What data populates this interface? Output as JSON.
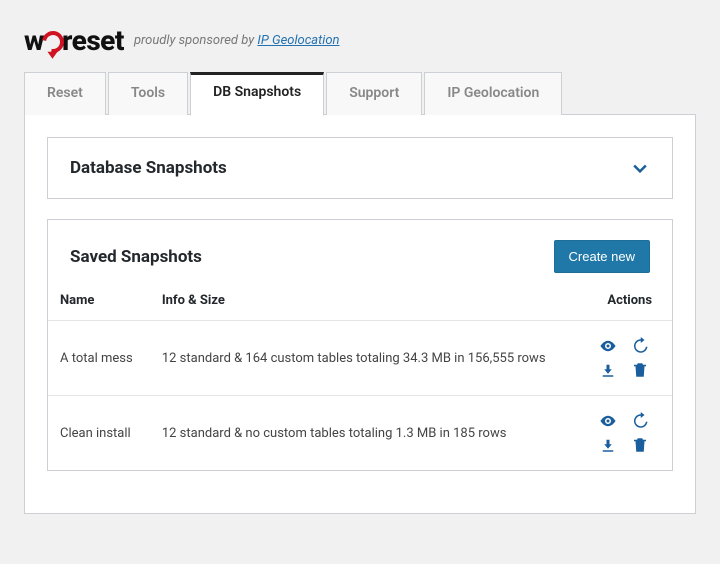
{
  "brand": {
    "text": "wpreset"
  },
  "sponsor": {
    "prefix": "proudly sponsored by ",
    "link_text": "IP Geolocation"
  },
  "tabs": [
    {
      "label": "Reset",
      "active": false
    },
    {
      "label": "Tools",
      "active": false
    },
    {
      "label": "DB Snapshots",
      "active": true
    },
    {
      "label": "Support",
      "active": false
    },
    {
      "label": "IP Geolocation",
      "active": false
    }
  ],
  "panel_db_snapshots": {
    "title": "Database Snapshots"
  },
  "panel_saved": {
    "title": "Saved Snapshots",
    "create_button": "Create new",
    "columns": {
      "name": "Name",
      "info": "Info & Size",
      "actions": "Actions"
    },
    "rows": [
      {
        "name": "A total mess",
        "info": "12 standard & 164 custom tables totaling 34.3 MB in 156,555 rows"
      },
      {
        "name": "Clean install",
        "info": "12 standard & no custom tables totaling 1.3 MB in 185 rows"
      }
    ]
  },
  "colors": {
    "accent": "#1b5e9e",
    "button": "#2078a8",
    "border": "#ccd0d4"
  }
}
